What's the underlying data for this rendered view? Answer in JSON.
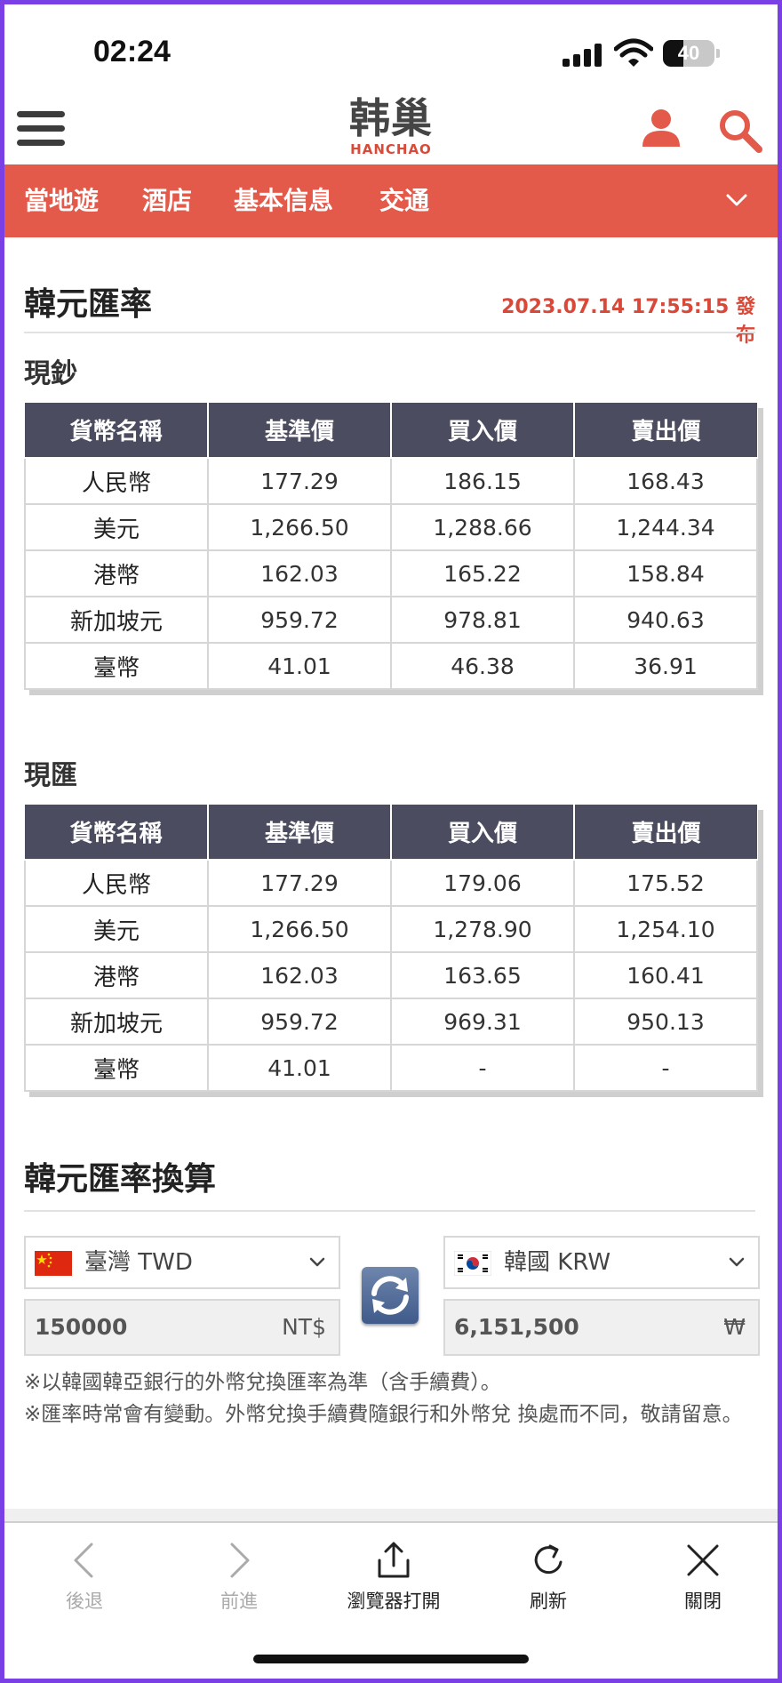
{
  "status_bar": {
    "time": "02:24",
    "battery": "40",
    "battery_level": 0.4
  },
  "header": {
    "logo_cn": "韩巢",
    "logo_en": "HANCHAO"
  },
  "nav": {
    "items": [
      "當地遊",
      "酒店",
      "基本信息",
      "交通"
    ]
  },
  "rates_section": {
    "title": "韓元匯率",
    "published": "2023.07.14 17:55:15 發布",
    "headers": [
      "貨幣名稱",
      "基準價",
      "買入價",
      "賣出價"
    ],
    "cash": {
      "title": "現鈔",
      "rows": [
        [
          "人民幣",
          "177.29",
          "186.15",
          "168.43"
        ],
        [
          "美元",
          "1,266.50",
          "1,288.66",
          "1,244.34"
        ],
        [
          "港幣",
          "162.03",
          "165.22",
          "158.84"
        ],
        [
          "新加坡元",
          "959.72",
          "978.81",
          "940.63"
        ],
        [
          "臺幣",
          "41.01",
          "46.38",
          "36.91"
        ]
      ]
    },
    "spot": {
      "title": "現匯",
      "rows": [
        [
          "人民幣",
          "177.29",
          "179.06",
          "175.52"
        ],
        [
          "美元",
          "1,266.50",
          "1,278.90",
          "1,254.10"
        ],
        [
          "港幣",
          "162.03",
          "163.65",
          "160.41"
        ],
        [
          "新加坡元",
          "959.72",
          "969.31",
          "950.13"
        ],
        [
          "臺幣",
          "41.01",
          "-",
          "-"
        ]
      ]
    }
  },
  "converter": {
    "title": "韓元匯率換算",
    "from": {
      "label": "臺灣 TWD",
      "amount": "150000",
      "unit": "NT$"
    },
    "to": {
      "label": "韓國 KRW",
      "amount": "6,151,500",
      "unit": "₩"
    },
    "note1": "※以韓國韓亞銀行的外幣兌換匯率為準（含手續費）。",
    "note2": "※匯率時常會有變動。外幣兌換手續費隨銀行和外幣兌 換處而不同，敬請留意。"
  },
  "bottom_bar": {
    "back": "後退",
    "forward": "前進",
    "open_browser": "瀏覽器打開",
    "refresh": "刷新",
    "close": "關閉"
  },
  "colors": {
    "brand_red": "#e3594a",
    "table_header": "#4b4c5f",
    "publish_red": "#d9493a"
  }
}
